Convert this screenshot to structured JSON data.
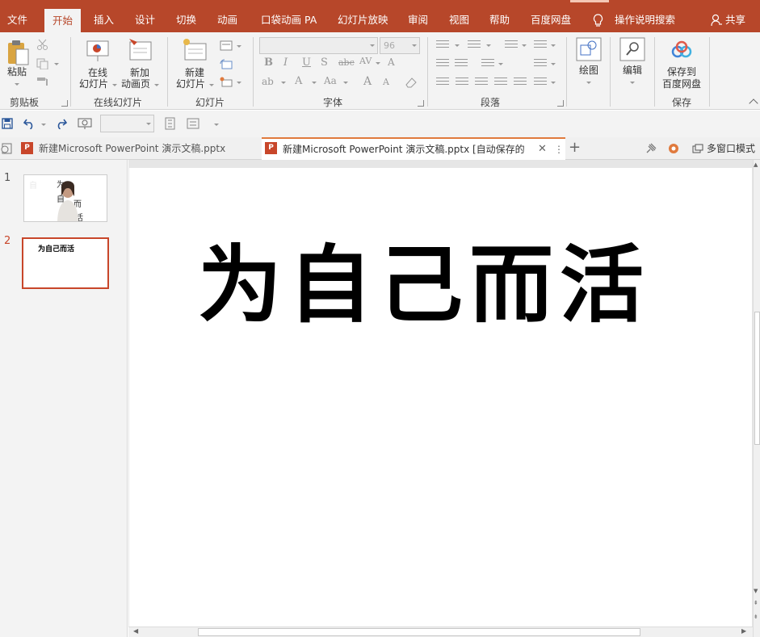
{
  "menu": {
    "tabs": [
      "文件",
      "开始",
      "插入",
      "设计",
      "切换",
      "动画",
      "口袋动画 PA",
      "幻灯片放映",
      "审阅",
      "视图",
      "帮助",
      "百度网盘"
    ],
    "active_tab": "开始",
    "search": "操作说明搜索",
    "share": "共享"
  },
  "ribbon": {
    "clipboard": {
      "paste": "粘贴",
      "group": "剪贴板"
    },
    "online_slides": {
      "online": "在线\n幻灯片",
      "online_l1": "在线",
      "online_l2": "幻灯片",
      "new_anim_l1": "新加",
      "new_anim_l2": "动画页",
      "group": "在线幻灯片"
    },
    "slides": {
      "new_l1": "新建",
      "new_l2": "幻灯片",
      "group": "幻灯片"
    },
    "font": {
      "size": "96",
      "group": "字体"
    },
    "paragraph": {
      "group": "段落"
    },
    "drawing": {
      "label": "绘图"
    },
    "editing": {
      "label": "编辑"
    },
    "save": {
      "l1": "保存到",
      "l2": "百度网盘",
      "group": "保存"
    }
  },
  "doc_tabs": [
    {
      "label": "新建Microsoft PowerPoint 演示文稿.pptx"
    },
    {
      "label": "新建Microsoft PowerPoint 演示文稿.pptx [自动保存的"
    }
  ],
  "doc_tabs_extra": {
    "multiwindow": "多窗口模式"
  },
  "slides": [
    {
      "number": "1"
    },
    {
      "number": "2",
      "thumb_title": "为自己而活"
    }
  ],
  "slide1_thumb_chars": [
    "自",
    "为",
    "自",
    "而",
    "活"
  ],
  "current_slide": {
    "title": "为自己而活"
  },
  "colors": {
    "accent": "#b7472a",
    "active_tab_line": "#e07a3d"
  }
}
